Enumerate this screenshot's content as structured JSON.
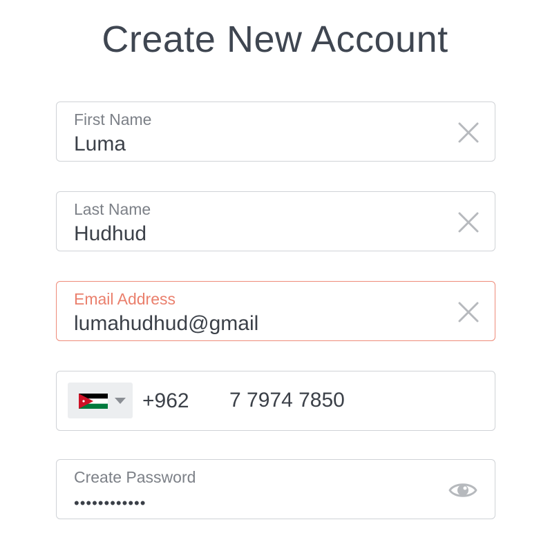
{
  "header": {
    "title": "Create New Account"
  },
  "form": {
    "first_name": {
      "label": "First Name",
      "value": "Luma"
    },
    "last_name": {
      "label": "Last Name",
      "value": "Hudhud"
    },
    "email": {
      "label": "Email Address",
      "value": "lumahudhud@gmail",
      "state": "error"
    },
    "phone": {
      "country_flag": "jordan-flag-icon",
      "dial_code": "+962",
      "number": "7 7974 7850"
    },
    "password": {
      "label": "Create Password",
      "masked_value": "••••••••••••"
    }
  },
  "icons": {
    "clear": "close-icon",
    "caret": "chevron-down-icon",
    "reveal": "eye-icon"
  },
  "colors": {
    "border": "#cfd2d6",
    "error": "#ea7f6c",
    "label": "#7c8087",
    "text": "#3b4048",
    "icon": "#b6b9bd"
  }
}
